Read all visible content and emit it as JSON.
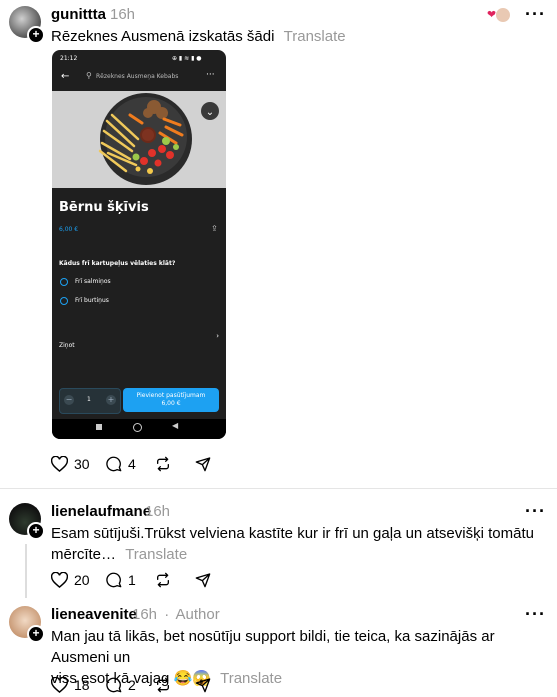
{
  "post": {
    "username": "gunittta",
    "time": "16h",
    "text": "Rēzeknes Ausmenā izskatās šādi",
    "translate": "Translate",
    "likes": "30",
    "replies": "4"
  },
  "phone": {
    "status_time": "21:12",
    "search_text": "Rēzeknes Ausmeņa Kebabs",
    "item_title": "Bērnu šķīvis",
    "price": "6,00 €",
    "question": "Kādus frī kartupeļus vēlaties klāt?",
    "options": [
      "Frī salmiņos",
      "Frī burtiņus"
    ],
    "notes_label": "Ziņot",
    "quantity": "1",
    "add_button": "Pievienot pasūtījumam",
    "add_price": "6,00 €"
  },
  "replies": [
    {
      "username": "lienelaufmane",
      "time": "16h",
      "author_tag": "",
      "text_line1": "Esam sūtījuši.Trūkst velviena kastīte kur ir frī un gaļa un atsevišķi tomātu",
      "text_line2": "mērcīte…",
      "translate": "Translate",
      "likes": "20",
      "replies": "1"
    },
    {
      "username": "lieneavenite",
      "time": "16h",
      "author_tag": "Author",
      "text_line1": "Man jau tā likās, bet nosūtīju support bildi, tie teica, ka sazinājās ar Ausmeni un",
      "text_line2": "viss esot kā vajag 😂😱",
      "translate": "Translate",
      "likes": "18",
      "replies": "2"
    }
  ],
  "colors": {
    "accent": "#1da1f2",
    "like_heart": "#e0245e",
    "phone_bg": "#1f1f1f"
  }
}
